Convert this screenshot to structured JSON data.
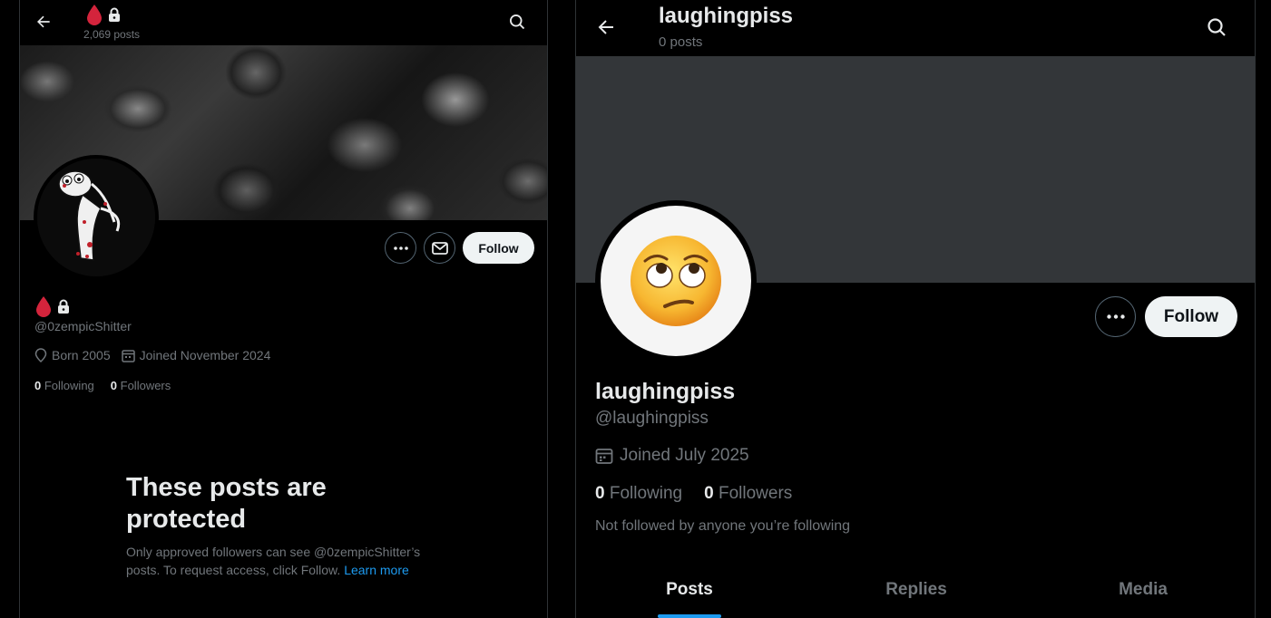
{
  "left_profile": {
    "header": {
      "post_count": "2,069 posts"
    },
    "buttons": {
      "follow_label": "Follow"
    },
    "handle": "@0zempicShitter",
    "meta": {
      "born": "Born 2005",
      "joined": "Joined November 2024"
    },
    "stats": {
      "following_count": "0",
      "following_label": "Following",
      "followers_count": "0",
      "followers_label": "Followers"
    },
    "protected": {
      "title": "These posts are protected",
      "text": "Only approved followers can see @0zempicShitter’s posts. To request access, click Follow.",
      "link": "Learn more"
    },
    "icons": [
      "back-arrow-icon",
      "blood-drop-icon",
      "lock-icon",
      "search-icon",
      "more-icon",
      "mail-icon",
      "location-icon",
      "calendar-icon"
    ]
  },
  "right_profile": {
    "header": {
      "title": "laughingpiss",
      "post_count": "0 posts"
    },
    "buttons": {
      "follow_label": "Follow"
    },
    "name": "laughingpiss",
    "handle": "@laughingpiss",
    "joined": "Joined July 2025",
    "stats": {
      "following_count": "0",
      "following_label": "Following",
      "followers_count": "0",
      "followers_label": "Followers"
    },
    "not_followed": "Not followed by anyone you’re following",
    "tabs": [
      {
        "label": "Posts",
        "active": true
      },
      {
        "label": "Replies",
        "active": false
      },
      {
        "label": "Media",
        "active": false
      }
    ],
    "icons": [
      "back-arrow-icon",
      "search-icon",
      "more-icon",
      "calendar-icon",
      "eye-roll-emoji-icon"
    ]
  },
  "colors": {
    "background": "#000000",
    "text_primary": "#e7e9ea",
    "text_secondary": "#71767b",
    "accent": "#1d9bf0",
    "follow_button": "#eff3f4",
    "banner_placeholder": "#333639",
    "blood_drop": "#d4243c"
  }
}
